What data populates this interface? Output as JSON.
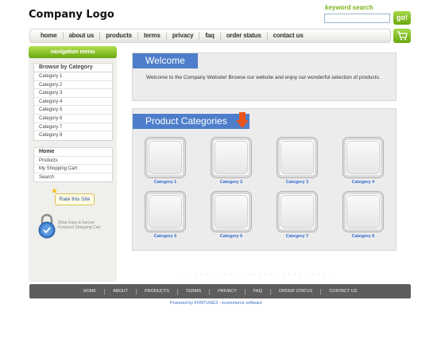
{
  "header": {
    "logo": "Company Logo",
    "search_label": "keyword search",
    "search_value": "",
    "go_label": "go!",
    "cart_icon": "shopping-cart-icon"
  },
  "top_nav": [
    "home",
    "about us",
    "products",
    "terms",
    "privacy",
    "faq",
    "order status",
    "contact us"
  ],
  "sidebar": {
    "nav_header": "navigation menu",
    "browse_header": "Browse by Category",
    "categories": [
      "Category 1",
      "Category 2",
      "Category 3",
      "Category 4",
      "Category 5",
      "Category 6",
      "Category 7",
      "Category 8"
    ],
    "links": [
      "Home",
      "Products",
      "My Shopping Cart",
      "Search"
    ],
    "rate_label": "Rate this Site",
    "secure_line1": "Shop Easy & Secure",
    "secure_line2": "Fortune3 Shopping Cart"
  },
  "welcome": {
    "title": "Welcome",
    "text": "Welcome to the Company Website! Browse our website and enjoy our wonderful selection of products."
  },
  "products": {
    "title": "Product Categories",
    "categories": [
      "Category 1",
      "Category 2",
      "Category 3",
      "Category 4",
      "Category 5",
      "Category 6",
      "Category 7",
      "Category 8"
    ]
  },
  "footer": {
    "links": [
      "HOME",
      "ABOUT",
      "PRODUCTS",
      "TERMS",
      "PRIVACY",
      "FAQ",
      "ORDER STATUS",
      "CONTACT US"
    ],
    "powered": "Powered by FORTUNE3 - ecommerce software"
  },
  "colors": {
    "accent_green": "#7ab317",
    "header_blue": "#4e7ecb",
    "link_blue": "#2f6ad1",
    "footer_gray": "#5d5d5d"
  }
}
